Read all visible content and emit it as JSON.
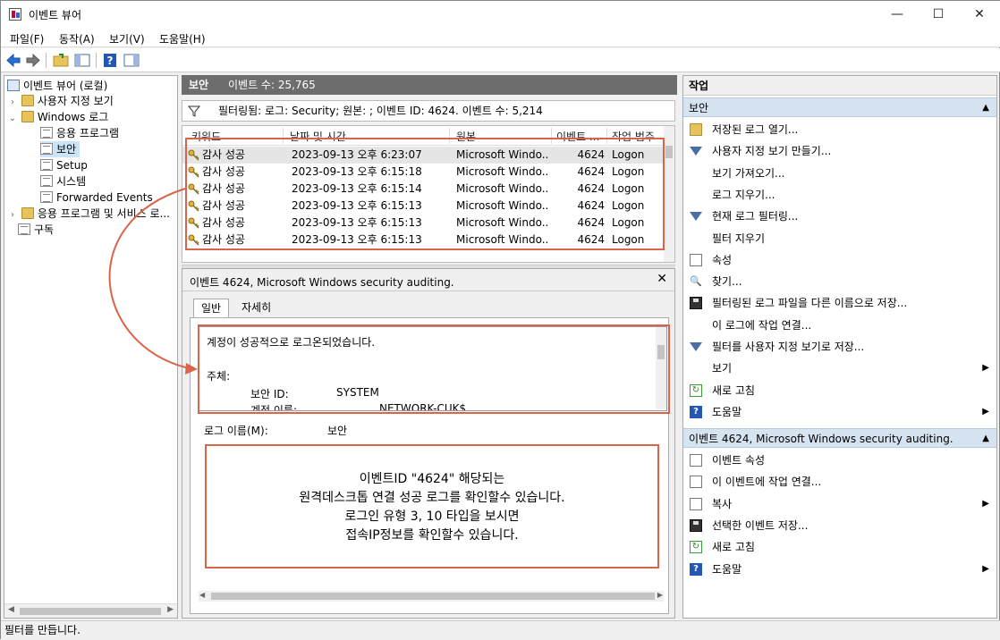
{
  "window": {
    "title": "이벤트 뷰어",
    "minimize": "—",
    "maximize": "☐",
    "close": "✕"
  },
  "menu": [
    "파일(F)",
    "동작(A)",
    "보기(V)",
    "도움말(H)"
  ],
  "tree": {
    "root": "이벤트 뷰어 (로컬)",
    "custom_views": "사용자 지정 보기",
    "windows_logs": "Windows 로그",
    "application": "응용 프로그램",
    "security": "보안",
    "setup": "Setup",
    "system": "시스템",
    "forwarded": "Forwarded Events",
    "app_services": "응용 프로그램 및 서비스 로...",
    "subscriptions": "구독"
  },
  "log_header": {
    "name": "보안",
    "count_label": "이벤트 수: 25,765"
  },
  "filter_text": "필터링됨: 로그: Security; 원본: ; 이벤트 ID: 4624. 이벤트 수: 5,214",
  "columns": [
    "키워드",
    "날짜 및 시간",
    "원본",
    "이벤트 ...",
    "작업 범주"
  ],
  "rows": [
    {
      "keyword": "감사 성공",
      "datetime": "2023-09-13 오후 6:23:07",
      "source": "Microsoft Windo...",
      "id": "4624",
      "category": "Logon"
    },
    {
      "keyword": "감사 성공",
      "datetime": "2023-09-13 오후 6:15:18",
      "source": "Microsoft Windo...",
      "id": "4624",
      "category": "Logon"
    },
    {
      "keyword": "감사 성공",
      "datetime": "2023-09-13 오후 6:15:14",
      "source": "Microsoft Windo...",
      "id": "4624",
      "category": "Logon"
    },
    {
      "keyword": "감사 성공",
      "datetime": "2023-09-13 오후 6:15:13",
      "source": "Microsoft Windo...",
      "id": "4624",
      "category": "Logon"
    },
    {
      "keyword": "감사 성공",
      "datetime": "2023-09-13 오후 6:15:13",
      "source": "Microsoft Windo...",
      "id": "4624",
      "category": "Logon"
    },
    {
      "keyword": "감사 성공",
      "datetime": "2023-09-13 오후 6:15:13",
      "source": "Microsoft Windo...",
      "id": "4624",
      "category": "Logon"
    }
  ],
  "detail": {
    "title": "이벤트 4624, Microsoft Windows security auditing.",
    "close": "✕",
    "tabs": [
      "일반",
      "자세히"
    ],
    "desc_intro": "계정이 성공적으로 로그온되었습니다.",
    "subject_label": "주체:",
    "security_id_label": "보안 ID:",
    "security_id_value": "SYSTEM",
    "account_name_label": "계정 이름:",
    "account_name_value": "NETWORK-CUK$",
    "log_name_label": "로그 이름(M):",
    "log_name_value": "보안"
  },
  "note": {
    "lines": [
      "이벤트ID \"4624\" 해당되는",
      "원격데스크톱 연결 성공 로그를 확인할수 있습니다.",
      "로그인 유형 3, 10 타입을 보시면",
      "접속IP정보를 확인할수 있습니다."
    ]
  },
  "actions": {
    "header": "작업",
    "section1": "보안",
    "items1": [
      {
        "label": "저장된 로그 열기...",
        "icon": "folder-icon"
      },
      {
        "label": "사용자 지정 보기 만들기...",
        "icon": "filter-icon"
      },
      {
        "label": "보기 가져오기...",
        "icon": ""
      },
      {
        "label": "로그 지우기...",
        "icon": ""
      },
      {
        "label": "현재 로그 필터링...",
        "icon": "filter-icon"
      },
      {
        "label": "필터 지우기",
        "icon": ""
      },
      {
        "label": "속성",
        "icon": "properties-icon"
      },
      {
        "label": "찾기...",
        "icon": "find-icon"
      },
      {
        "label": "필터링된 로그 파일을 다른 이름으로 저장...",
        "icon": "save-icon"
      },
      {
        "label": "이 로그에 작업 연결...",
        "icon": ""
      },
      {
        "label": "필터를 사용자 지정 보기로 저장...",
        "icon": "filter-save-icon"
      },
      {
        "label": "보기",
        "icon": "",
        "submenu": true
      },
      {
        "label": "새로 고침",
        "icon": "refresh-icon"
      },
      {
        "label": "도움말",
        "icon": "help-icon",
        "submenu": true
      }
    ],
    "section2": "이벤트 4624, Microsoft Windows security auditing.",
    "items2": [
      {
        "label": "이벤트 속성",
        "icon": "properties-icon"
      },
      {
        "label": "이 이벤트에 작업 연결...",
        "icon": "task-icon"
      },
      {
        "label": "복사",
        "icon": "copy-icon",
        "submenu": true
      },
      {
        "label": "선택한 이벤트 저장...",
        "icon": "save-icon"
      },
      {
        "label": "새로 고침",
        "icon": "refresh-icon"
      },
      {
        "label": "도움말",
        "icon": "help-icon",
        "submenu": true
      }
    ]
  },
  "status": "필터를 만듭니다.",
  "colors": {
    "annotation": "#d9644a",
    "section": "#d6e3f1",
    "header_bar": "#6d6d6d"
  }
}
